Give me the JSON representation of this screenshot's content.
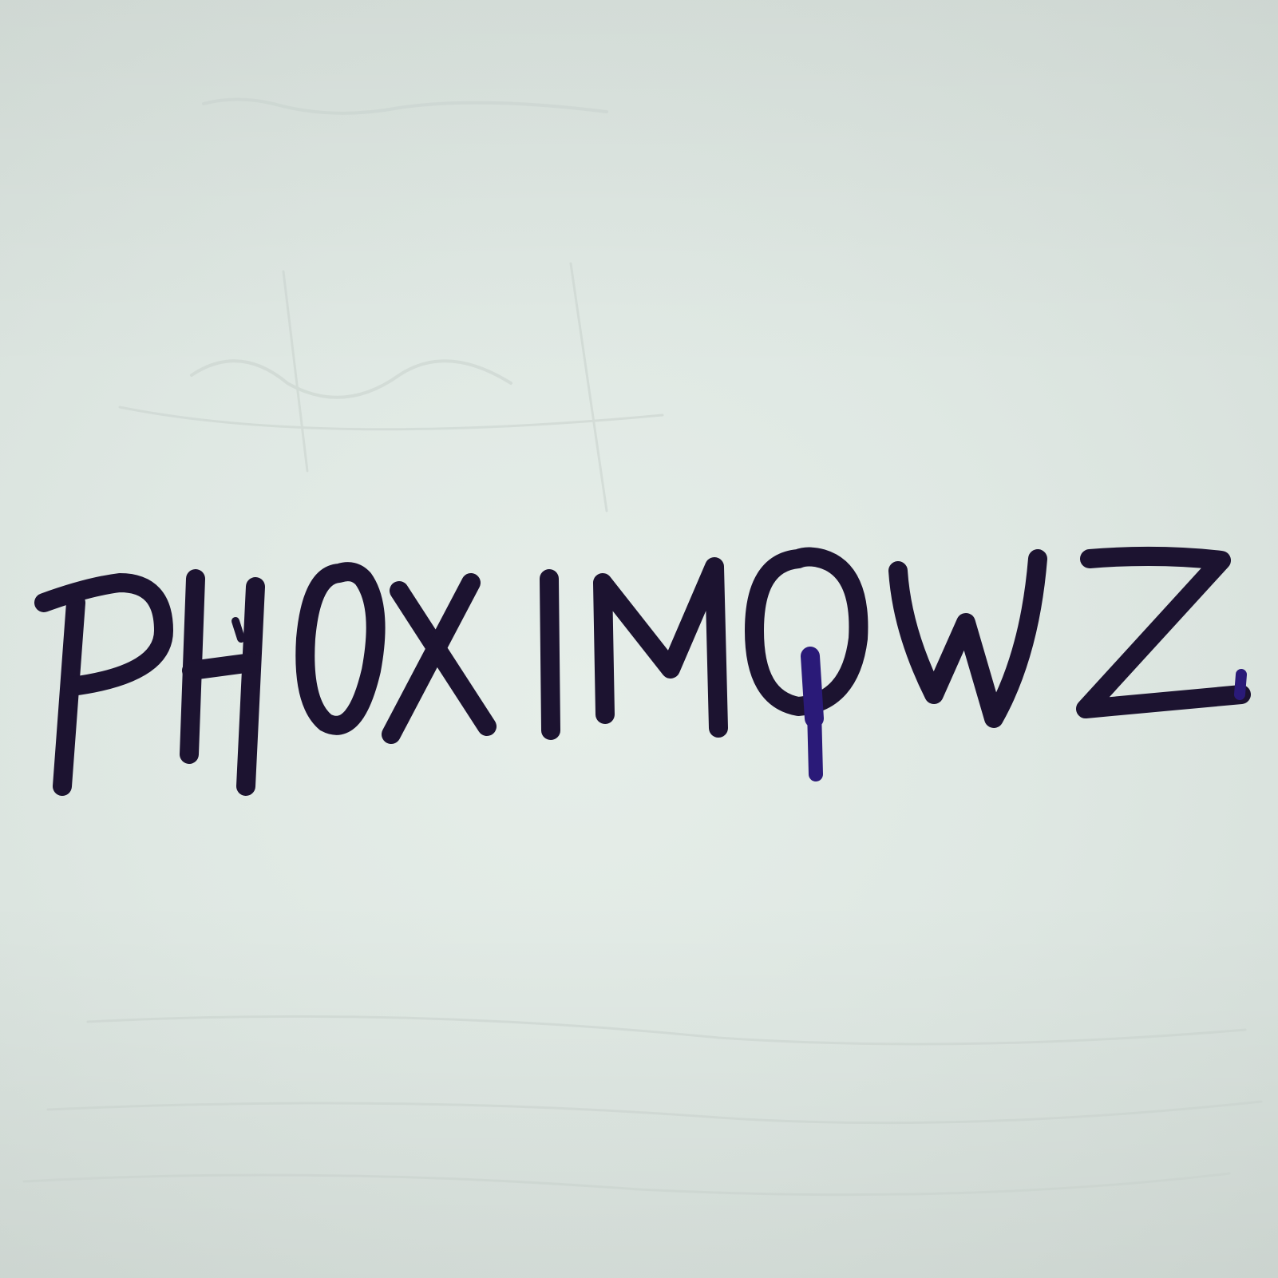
{
  "handwritten_word": "PHOXIMQWZ",
  "letters": [
    "P",
    "H",
    "O",
    "X",
    "I",
    "M",
    "Q",
    "W",
    "Z"
  ],
  "colors": {
    "paper": "#e0e9e4",
    "ink": "#1c1330",
    "ink_blue": "#2a1a78"
  }
}
